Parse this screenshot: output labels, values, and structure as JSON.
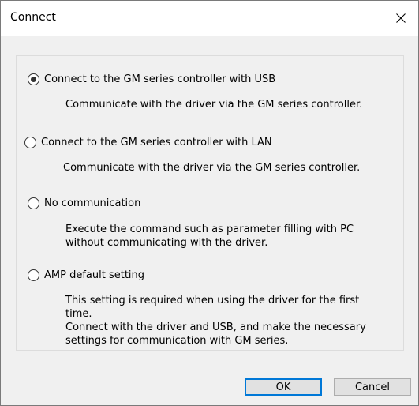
{
  "window": {
    "title": "Connect"
  },
  "options": [
    {
      "label": "Connect to the GM series controller with USB",
      "checked": true,
      "description": [
        "Communicate with the driver via the GM series controller."
      ]
    },
    {
      "label": "Connect to the GM series controller with LAN",
      "checked": false,
      "description": [
        "Communicate with the driver via the GM series controller."
      ]
    },
    {
      "label": "No communication",
      "checked": false,
      "description": [
        "Execute the command such as parameter filling with PC",
        "without communicating with the driver."
      ]
    },
    {
      "label": "AMP default setting",
      "checked": false,
      "description": [
        "This setting is required when using the driver for the first",
        "time.",
        "Connect with the driver and USB, and make the necessary",
        "settings for communication with GM series."
      ]
    }
  ],
  "buttons": {
    "ok": "OK",
    "cancel": "Cancel"
  },
  "colors": {
    "accent": "#0078d7",
    "dialog_bg": "#f0f0f0",
    "titlebar_bg": "#ffffff"
  },
  "icons": {
    "close": "close-icon"
  }
}
